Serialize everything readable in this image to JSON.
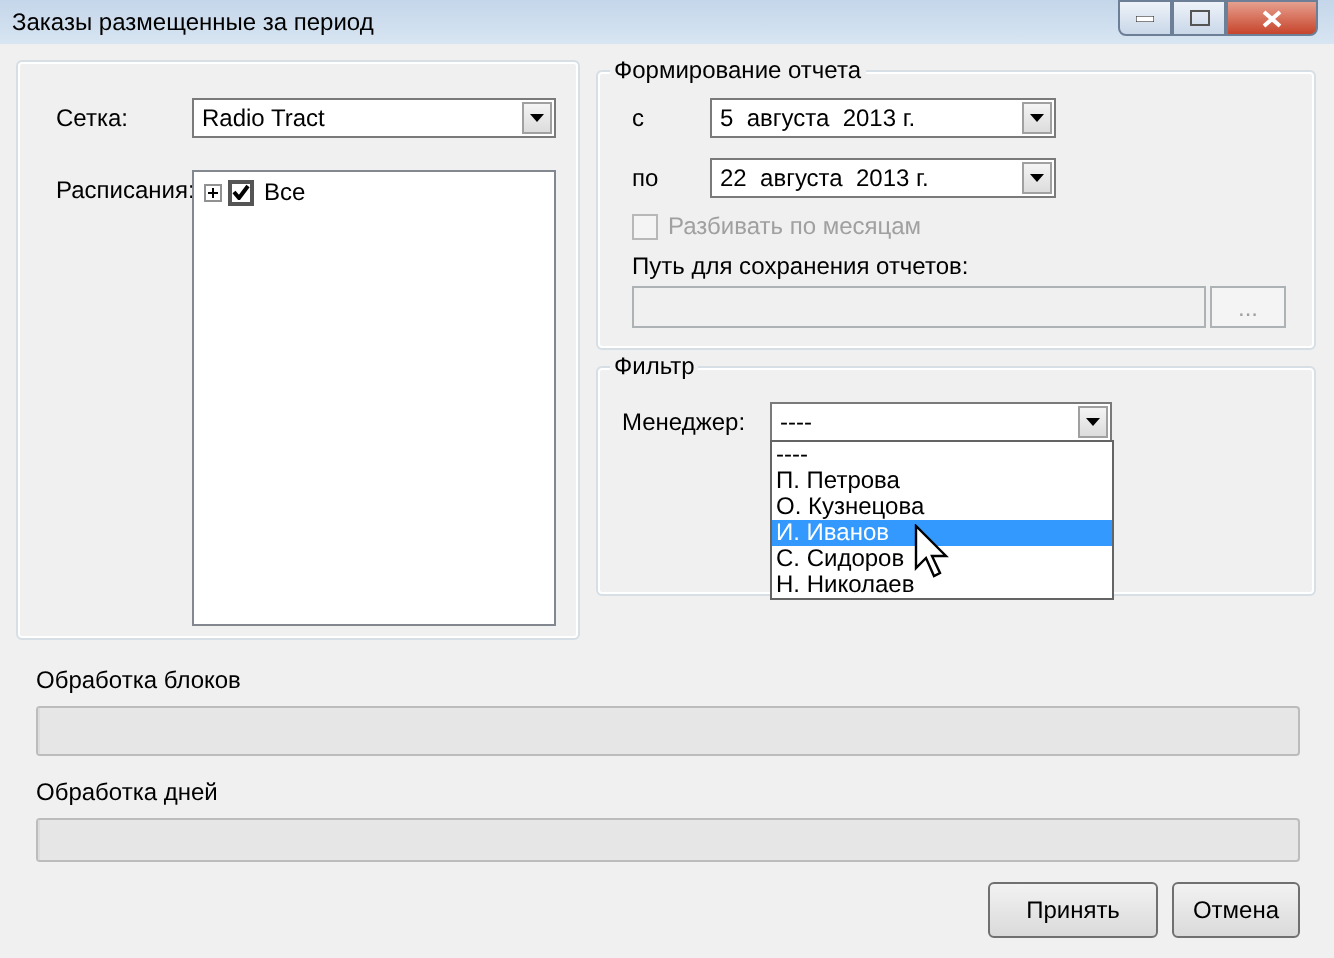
{
  "window": {
    "title": "Заказы размещенные за период"
  },
  "schedule": {
    "grid_label": "Сетка:",
    "grid_value": "Radio Tract",
    "schedules_label": "Расписания:",
    "tree": [
      {
        "label": "Все",
        "checked": true,
        "expanded": false
      }
    ]
  },
  "report": {
    "title": "Формирование отчета",
    "from_label": "с",
    "from_value": "5  августа  2013 г.",
    "to_label": "по",
    "to_value": "22  августа  2013 г.",
    "split_by_month": {
      "label": "Разбивать по месяцам",
      "checked": false,
      "disabled": true
    },
    "path_label": "Путь для сохранения отчетов:",
    "path_value_disabled": true,
    "browse_button": "..."
  },
  "filter": {
    "title": "Фильтр",
    "manager_label": "Менеджер:",
    "manager_value": "----",
    "options": [
      {
        "label": "----",
        "selected": false
      },
      {
        "label": "П. Петрова",
        "selected": false
      },
      {
        "label": "О. Кузнецова",
        "selected": false
      },
      {
        "label": "И. Иванов",
        "selected": true
      },
      {
        "label": "С. Сидоров",
        "selected": false
      },
      {
        "label": "Н. Николаев",
        "selected": false
      }
    ]
  },
  "progress": [
    {
      "label": "Обработка блоков",
      "level": 0
    },
    {
      "label": "Обработка дней",
      "level": 0
    }
  ],
  "buttons": [
    "Принять",
    "Отмена"
  ]
}
